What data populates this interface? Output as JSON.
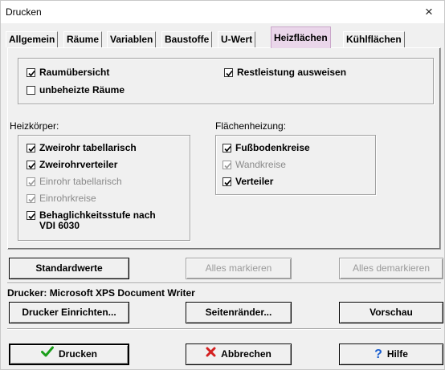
{
  "window": {
    "title": "Drucken",
    "close_glyph": "×"
  },
  "tabs": [
    {
      "label": "Allgemein"
    },
    {
      "label": "Räume"
    },
    {
      "label": "Variablen"
    },
    {
      "label": "Baustoffe"
    },
    {
      "label": "U-Wert"
    },
    {
      "label": "Heizflächen",
      "active": true
    },
    {
      "label": "Kühlflächen"
    }
  ],
  "top_options": {
    "raumuebersicht": {
      "label": "Raumübersicht",
      "checked": true
    },
    "unbeheizte": {
      "label": "unbeheizte Räume",
      "checked": false
    },
    "restleistung": {
      "label": "Restleistung ausweisen",
      "checked": true
    }
  },
  "heizkoerper": {
    "title": "Heizkörper:",
    "items": [
      {
        "label": "Zweirohr tabellarisch",
        "checked": true,
        "enabled": true
      },
      {
        "label": "Zweirohrverteiler",
        "checked": true,
        "enabled": true
      },
      {
        "label": "Einrohr tabellarisch",
        "checked": true,
        "enabled": false
      },
      {
        "label": "Einrohrkreise",
        "checked": true,
        "enabled": false
      },
      {
        "label": "Behaglichkeitsstufe nach VDI 6030",
        "checked": true,
        "enabled": true
      }
    ]
  },
  "flaechenheizung": {
    "title": "Flächenheizung:",
    "items": [
      {
        "label": "Fußbodenkreise",
        "checked": true,
        "enabled": true
      },
      {
        "label": "Wandkreise",
        "checked": true,
        "enabled": false
      },
      {
        "label": "Verteiler",
        "checked": true,
        "enabled": true
      }
    ]
  },
  "buttons": {
    "standardwerte": "Standardwerte",
    "alles_markieren": "Alles markieren",
    "alles_demarkieren": "Alles demarkieren",
    "drucker_einrichten": "Drucker Einrichten...",
    "seitenraender": "Seitenränder...",
    "vorschau": "Vorschau",
    "drucken": "Drucken",
    "abbrechen": "Abbrechen",
    "hilfe": "Hilfe"
  },
  "printer_label": "Drucker: Microsoft XPS Document Writer",
  "colors": {
    "accent_tab": "#ead6ea",
    "check_green": "#1a9e1a",
    "cancel_red": "#d42020",
    "help_blue": "#1b5fd0"
  }
}
